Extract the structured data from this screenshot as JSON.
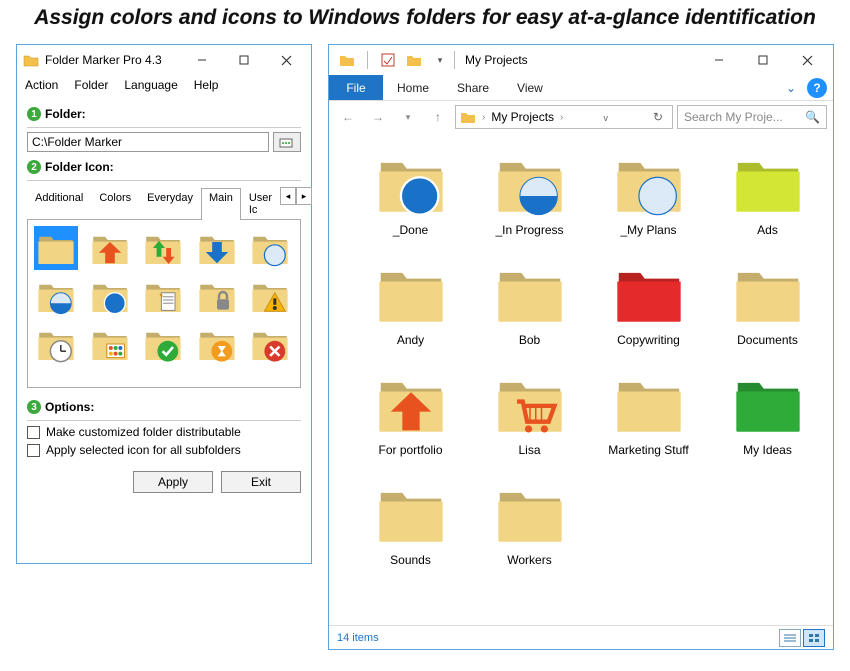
{
  "headline": "Assign colors and icons to Windows folders for easy at-a-glance identification",
  "fm": {
    "title": "Folder Marker Pro 4.3",
    "menu": [
      "Action",
      "Folder",
      "Language",
      "Help"
    ],
    "section_folder": "Folder:",
    "path": "C:\\Folder Marker",
    "section_icon": "Folder Icon:",
    "tabs": [
      "Additional",
      "Colors",
      "Everyday",
      "Main",
      "User Ic"
    ],
    "active_tab": 3,
    "section_options": "Options:",
    "opt1": "Make customized folder distributable",
    "opt2": "Apply selected icon for all subfolders",
    "btn_apply": "Apply",
    "btn_exit": "Exit",
    "icons": [
      {
        "name": "plain-folder",
        "selected": true
      },
      {
        "name": "folder-up-arrow"
      },
      {
        "name": "folder-updown-arrow"
      },
      {
        "name": "folder-down-arrow"
      },
      {
        "name": "folder-pie-empty"
      },
      {
        "name": "folder-pie-half"
      },
      {
        "name": "folder-pie-full"
      },
      {
        "name": "folder-document"
      },
      {
        "name": "folder-lock"
      },
      {
        "name": "folder-warning"
      },
      {
        "name": "folder-clock"
      },
      {
        "name": "folder-dots"
      },
      {
        "name": "folder-check"
      },
      {
        "name": "folder-hourglass"
      },
      {
        "name": "folder-deny"
      }
    ]
  },
  "explorer": {
    "window_title": "My Projects",
    "ribbon": {
      "file": "File",
      "tabs": [
        "Home",
        "Share",
        "View"
      ]
    },
    "breadcrumb": "My Projects",
    "search_placeholder": "Search My Proje...",
    "status": "14 items",
    "folders": [
      {
        "name": "_Done",
        "color": "#f1d484",
        "overlay": "pie-full"
      },
      {
        "name": "_In Progress",
        "color": "#f1d484",
        "overlay": "pie-half"
      },
      {
        "name": "_My Plans",
        "color": "#f1d484",
        "overlay": "pie-empty"
      },
      {
        "name": "Ads",
        "color": "#d4e635"
      },
      {
        "name": "Andy",
        "color": "#f1d484"
      },
      {
        "name": "Bob",
        "color": "#f1d484"
      },
      {
        "name": "Copywriting",
        "color": "#e42a2a"
      },
      {
        "name": "Documents",
        "color": "#f1d484"
      },
      {
        "name": "For portfolio",
        "color": "#f1d484",
        "overlay": "up-arrow"
      },
      {
        "name": "Lisa",
        "color": "#f1d484",
        "overlay": "cart"
      },
      {
        "name": "Marketing Stuff",
        "color": "#f1d484"
      },
      {
        "name": "My Ideas",
        "color": "#2fab3a"
      },
      {
        "name": "Sounds",
        "color": "#f1d484"
      },
      {
        "name": "Workers",
        "color": "#f1d484"
      }
    ]
  }
}
